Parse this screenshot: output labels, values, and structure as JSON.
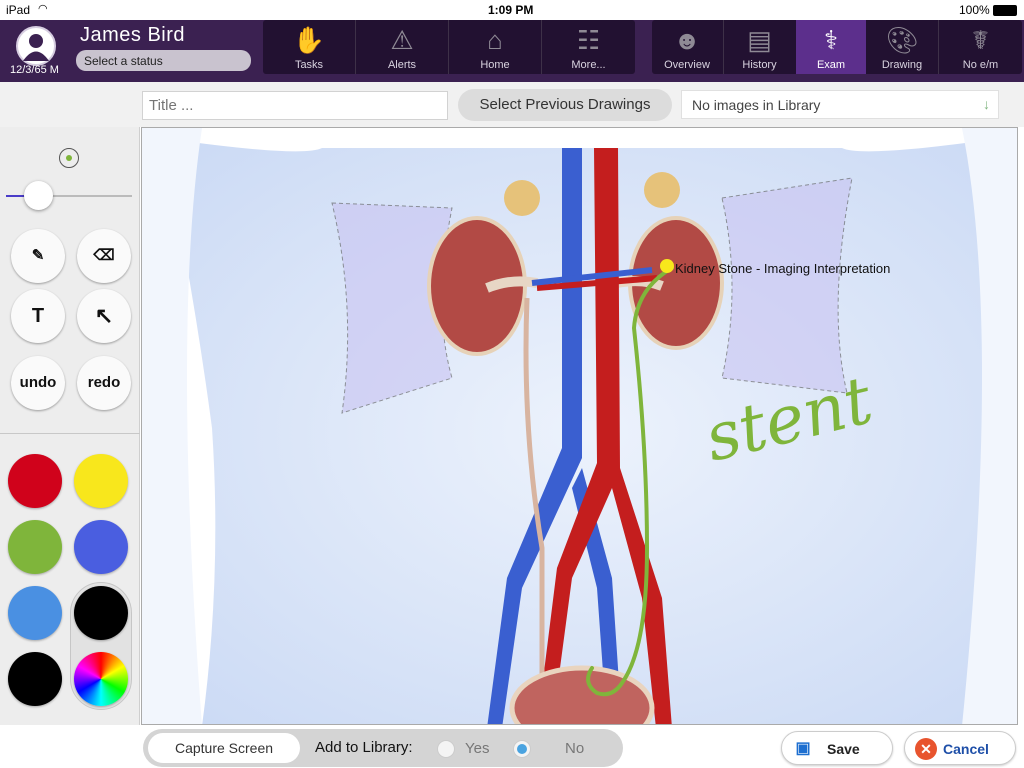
{
  "status_bar": {
    "device": "iPad",
    "time": "1:09 PM",
    "battery": "100%"
  },
  "patient": {
    "name": "James  Bird",
    "dob": "12/3/65 M",
    "status_placeholder": "Select a status",
    "avatar_icon": "user-avatar-icon"
  },
  "nav_left": [
    {
      "label": "Tasks",
      "icon": "hand-icon"
    },
    {
      "label": "Alerts",
      "icon": "warning-icon"
    },
    {
      "label": "Home",
      "icon": "home-icon"
    },
    {
      "label": "More...",
      "icon": "sitemap-icon"
    }
  ],
  "nav_right": [
    {
      "label": "Overview",
      "icon": "head-profile-icon"
    },
    {
      "label": "History",
      "icon": "clipboard-icon"
    },
    {
      "label": "Exam",
      "icon": "stethoscope-icon",
      "active": true
    },
    {
      "label": "Drawing",
      "icon": "palette-icon"
    },
    {
      "label": "No e/m",
      "icon": "caduceus-icon"
    }
  ],
  "toolbar": {
    "title_placeholder": "Title ...",
    "prev_drawings": "Select Previous Drawings",
    "library_value": "No images in Library"
  },
  "tools": {
    "undo": "undo",
    "redo": "redo",
    "text": "T"
  },
  "colors": [
    "#d0021b",
    "#f8e71c",
    "#7fb53b",
    "#4a5ee0",
    "#4a90e2",
    "#000000",
    "#000000"
  ],
  "canvas": {
    "annotation": "Kidney Stone - Imaging Interpretation",
    "handwriting": "stent"
  },
  "bottom": {
    "capture": "Capture Screen",
    "add_to_library": "Add to Library:",
    "yes": "Yes",
    "no": "No",
    "save": "Save",
    "cancel": "Cancel"
  }
}
